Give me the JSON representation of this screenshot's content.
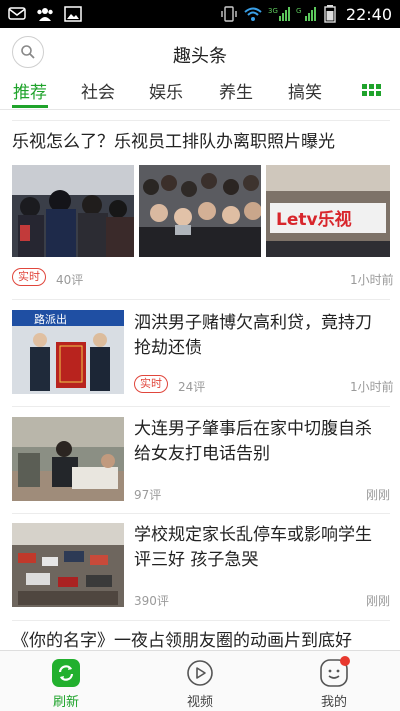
{
  "status_bar": {
    "time": "22:40",
    "network_labels": [
      "3G",
      "G"
    ]
  },
  "header": {
    "title": "趣头条"
  },
  "tabs": [
    {
      "label": "推荐",
      "active": true
    },
    {
      "label": "社会",
      "active": false
    },
    {
      "label": "娱乐",
      "active": false
    },
    {
      "label": "养生",
      "active": false
    },
    {
      "label": "搞笑",
      "active": false
    }
  ],
  "feed": {
    "items": [
      {
        "title": "乐视怎么了？乐视员工排队办离职照片曝光",
        "tag": "实时",
        "comments": "40评",
        "time": "1小时前",
        "image_text": "Letv乐视"
      },
      {
        "title": "泗洪男子赌博欠高利贷，竟持刀抢劫还债",
        "tag": "实时",
        "comments": "24评",
        "time": "1小时前",
        "image_text": "路派出"
      },
      {
        "title": "大连男子肇事后在家中切腹自杀给女友打电话告别",
        "comments": "97评",
        "time": "刚刚"
      },
      {
        "title": "学校规定家长乱停车或影响学生评三好 孩子急哭",
        "comments": "390评",
        "time": "刚刚"
      },
      {
        "title": "《你的名字》一夜占领朋友圈的动画片到底好"
      }
    ]
  },
  "bottom_nav": [
    {
      "label": "刷新",
      "icon": "refresh-icon",
      "active": true
    },
    {
      "label": "视频",
      "icon": "play-icon",
      "active": false
    },
    {
      "label": "我的",
      "icon": "smiley-icon",
      "active": false,
      "badge": true
    }
  ],
  "colors": {
    "accent": "#1fa32b",
    "tag_red": "#e0463c",
    "badge": "#e8392f"
  }
}
